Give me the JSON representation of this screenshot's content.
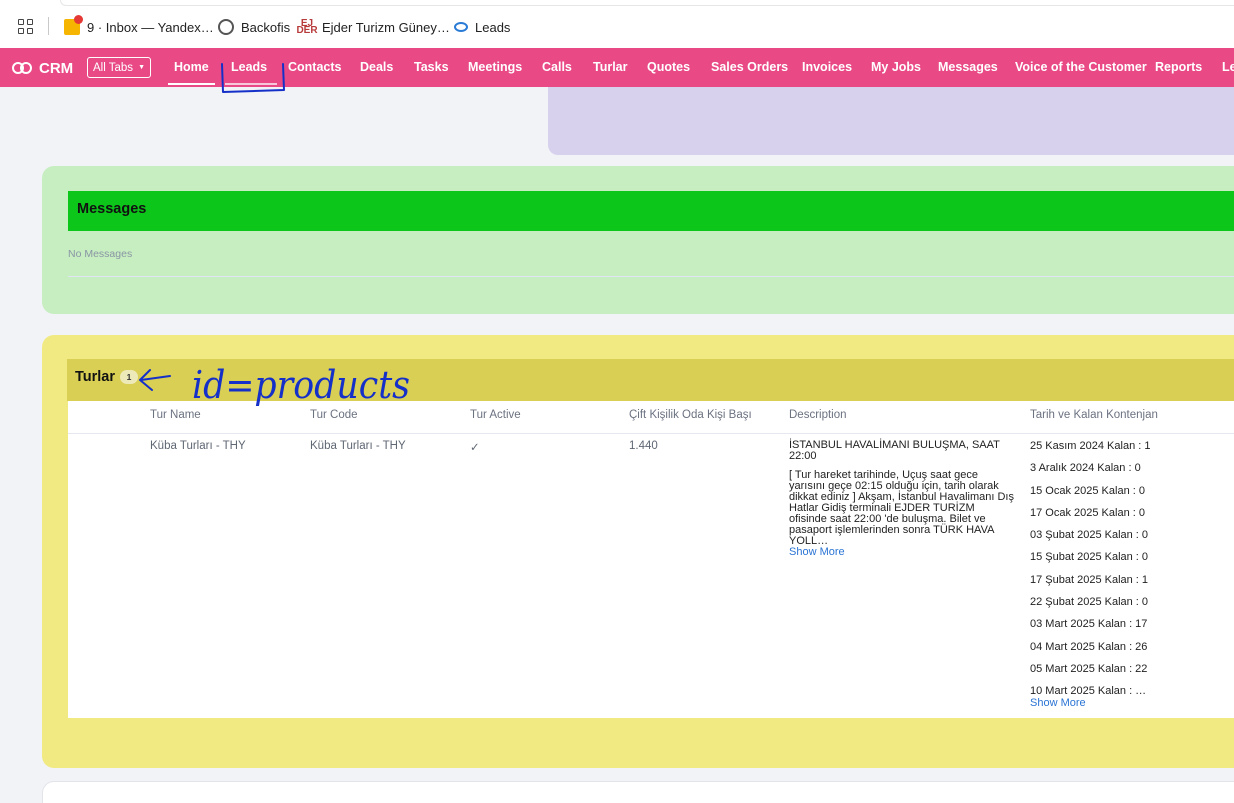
{
  "bookmarks": [
    {
      "label": "9 · Inbox — Yandex…",
      "icon": "yandex-mail-icon"
    },
    {
      "label": "Backofis",
      "icon": "globe-icon"
    },
    {
      "label": "Ejder Turizm Güney…",
      "icon": "ejder-turizm-logo-icon"
    },
    {
      "label": "Leads",
      "icon": "leads-link-icon"
    }
  ],
  "nav": {
    "brand": "CRM",
    "all_tabs": "All Tabs",
    "items": [
      "Home",
      "Leads",
      "Contacts",
      "Deals",
      "Tasks",
      "Meetings",
      "Calls",
      "Turlar",
      "Quotes",
      "Sales Orders",
      "Invoices",
      "My Jobs",
      "Messages",
      "Voice of the Customer",
      "Reports",
      "Le"
    ],
    "active": "Home",
    "accent_color": "#e94a86"
  },
  "messages": {
    "title": "Messages",
    "empty_text": "No Messages",
    "header_color": "#0cc71a"
  },
  "turlar": {
    "title": "Turlar",
    "count": "1",
    "columns": [
      "Tur Name",
      "Tur Code",
      "Tur Active",
      "Çift Kişilik Oda Kişi Başı",
      "Description",
      "Tarih ve Kalan Kontenjan"
    ],
    "row": {
      "tur_name": "Küba Turları - THY",
      "tur_code": "Küba Turları - THY",
      "tur_active": "✓",
      "price": "1.440",
      "description_1": "İSTANBUL HAVALİMANI BULUŞMA, SAAT 22:00",
      "description_2": "[ Tur hareket tarihinde, Uçuş saat gece yarısını geçe 02:15 olduğu için, tarih olarak dikkat ediniz ] Akşam, İstanbul Havalimanı Dış Hatlar Gidiş terminali EJDER TURİZM ofisinde saat 22:00 'de buluşma. Bilet ve pasaport işlemlerinden sonra TÜRK HAVA YOLL…",
      "dates": [
        "25 Kasım 2024 Kalan : 1",
        "3 Aralık 2024 Kalan : 0",
        "15 Ocak 2025 Kalan : 0",
        "17 Ocak 2025 Kalan : 0",
        "03 Şubat 2025 Kalan : 0",
        "15 Şubat 2025 Kalan : 0",
        "17 Şubat 2025 Kalan : 1",
        "22 Şubat 2025 Kalan : 0",
        "03 Mart 2025 Kalan : 17",
        "04 Mart 2025 Kalan : 26",
        "05 Mart 2025 Kalan : 22",
        "10 Mart 2025 Kalan : …"
      ]
    },
    "show_more": "Show More"
  },
  "annotations": {
    "handwritten_note": "id=products",
    "ink_color": "#1530c8"
  }
}
